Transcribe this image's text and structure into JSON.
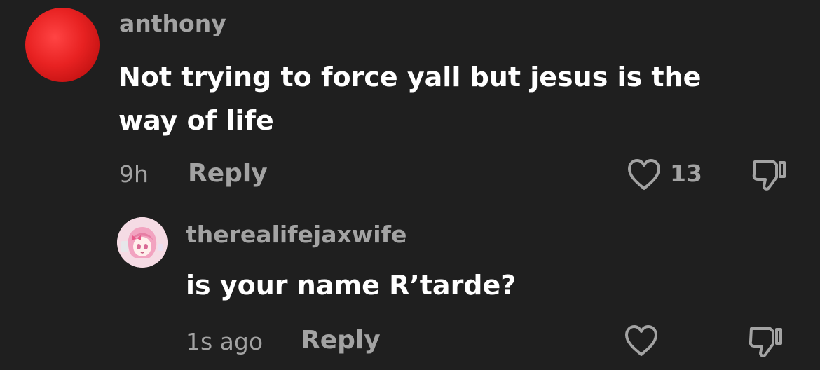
{
  "comment": {
    "username": "anthony",
    "text": "Not trying to force yall but jesus is the way of life",
    "time": "9h",
    "reply_label": "Reply",
    "like_count": "13"
  },
  "reply": {
    "username": "therealifejaxwife",
    "text": "is your name R’tarde?",
    "time": "1s ago",
    "reply_label": "Reply"
  },
  "icons": {
    "like": "heart-outline-icon",
    "dislike": "thumbs-down-outline-icon"
  },
  "colors": {
    "background": "#1f1f1f",
    "primary_text": "#ffffff",
    "secondary_text": "#a3a3a3",
    "main_avatar": "#e82222"
  }
}
